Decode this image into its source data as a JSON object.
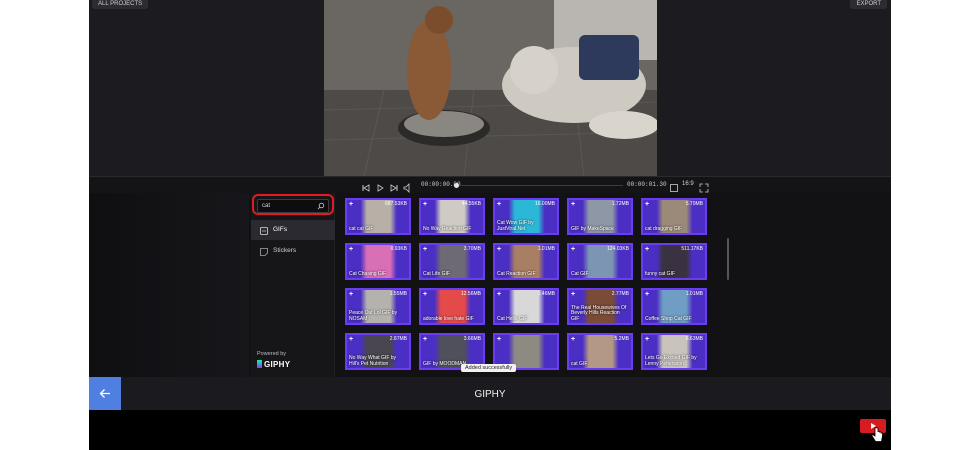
{
  "top": {
    "left_button": "ALL PROJECTS",
    "right_button": "EXPORT"
  },
  "playback": {
    "current_time": "00:00:00.00",
    "total_time": "00:00:01.30",
    "ratio": "16:9"
  },
  "sidebar": {
    "search_value": "cat",
    "items": [
      {
        "label": "GIFs",
        "icon": "gif-icon",
        "active": true
      },
      {
        "label": "Stickers",
        "icon": "sticker-icon",
        "active": false
      }
    ],
    "powered_by": "Powered by",
    "brand": "GIPHY"
  },
  "grid": {
    "tiles": [
      {
        "title": "cat cat GIF",
        "size": "687.53KB",
        "hue": "#b8b0a6"
      },
      {
        "title": "No Way Reaction GIF",
        "size": "44.55KB",
        "hue": "#cfcac4"
      },
      {
        "title": "Cat Wow GIF by JustViral.Net",
        "size": "16.00MB",
        "hue": "#2bb7d6"
      },
      {
        "title": "GIF by MakeSpace",
        "size": "1.72MB",
        "hue": "#8e97a5"
      },
      {
        "title": "cat dragging GIF",
        "size": "5.70MB",
        "hue": "#9c8a78"
      },
      {
        "title": "Cat Chasing GIF",
        "size": "0.93KB",
        "hue": "#d96fb4"
      },
      {
        "title": "Cat Life GIF",
        "size": "3.70MB",
        "hue": "#6d6a74"
      },
      {
        "title": "Cat Reaction GIF",
        "size": "1.01MB",
        "hue": "#a87f62"
      },
      {
        "title": "Cat GIF",
        "size": "124.03KB",
        "hue": "#7c95b2"
      },
      {
        "title": "funny cat GIF",
        "size": "511.17KB",
        "hue": "#3a3240"
      },
      {
        "title": "Peace Out Lol GIF by NOSAM",
        "size": "1.55MB",
        "hue": "#b5b2ad"
      },
      {
        "title": "adorable love hate GIF",
        "size": "12.56MB",
        "hue": "#e54a4a"
      },
      {
        "title": "Cat Hello GIF",
        "size": "1.46MB",
        "hue": "#d8d8d8"
      },
      {
        "title": "The Real Housewives Of Beverly Hills Reaction GIF",
        "size": "2.77MB",
        "hue": "#7a4b36"
      },
      {
        "title": "Coffee Shop Cat GIF",
        "size": "1.01MB",
        "hue": "#6f9dc3"
      },
      {
        "title": "No Way What GIF by Hill's Pet Nutrition",
        "size": "2.87MB",
        "hue": "#494650"
      },
      {
        "title": "GIF by MOODMAN",
        "size": "3.66MB",
        "hue": "#50505c"
      },
      {
        "title": "",
        "size": "",
        "hue": "#8e8a82"
      },
      {
        "title": "cat GIF",
        "size": "5.2MB",
        "hue": "#b49886"
      },
      {
        "title": "Lets Go Excited GIF by Lenny Pettersson",
        "size": "6.63MB",
        "hue": "#c9c3bb"
      }
    ]
  },
  "tooltip": "Added successfully",
  "bottom": {
    "title": "GIPHY"
  },
  "colors": {
    "accent": "#6a3df0",
    "highlight": "#e11b22",
    "back": "#4f7fe0"
  }
}
